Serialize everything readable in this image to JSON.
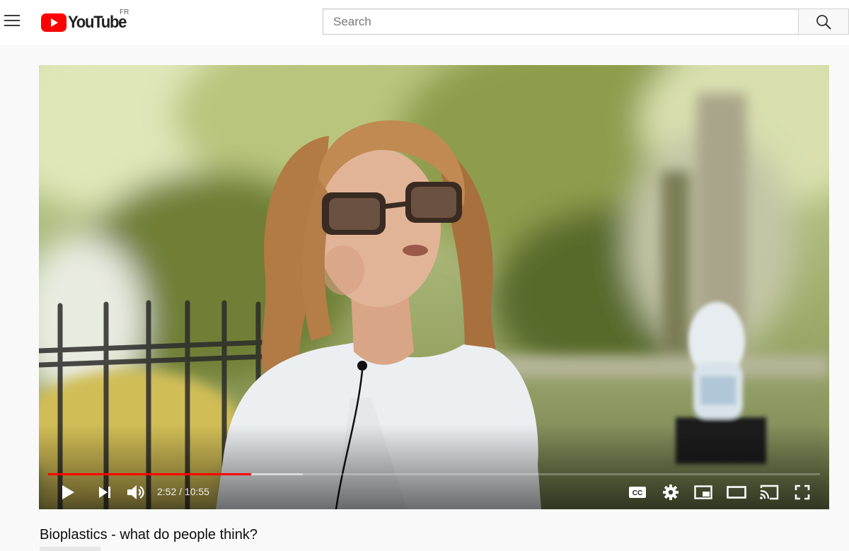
{
  "masthead": {
    "logo_text": "YouTube",
    "country_code": "FR",
    "search_placeholder": "Search",
    "icons": {
      "menu": "hamburger-menu-icon",
      "search": "magnifier-icon"
    },
    "brand_color": "#ff0000"
  },
  "player": {
    "time_current": "2:52",
    "time_separator": " / ",
    "time_total": "10:55",
    "progress_fraction": 0.263,
    "buffered_fraction": 0.33,
    "progress_color": "#ff0000",
    "controls": {
      "play": "play-icon",
      "next": "next-icon",
      "volume": "volume-icon",
      "subtitles": "subtitles-cc-icon",
      "settings": "gear-icon",
      "miniplayer": "miniplayer-icon",
      "theater": "theater-mode-icon",
      "cast": "cast-icon",
      "fullscreen": "fullscreen-icon"
    }
  },
  "video": {
    "title": "Bioplastics - what do people think?"
  }
}
